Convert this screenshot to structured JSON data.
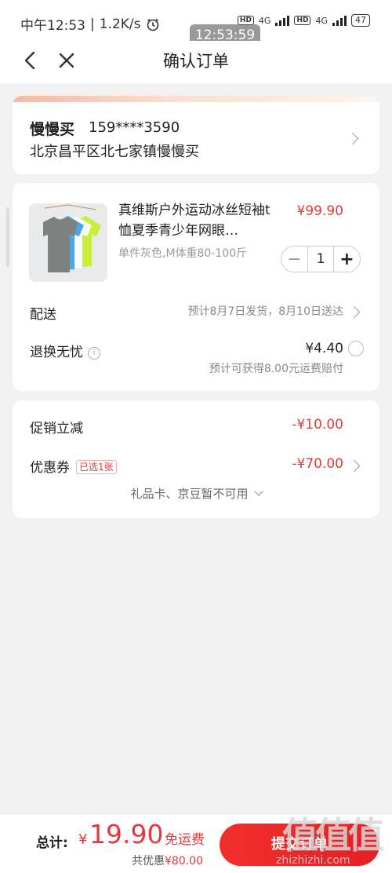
{
  "status_bar": {
    "time": "中午12:53",
    "speed": "1.2K/s",
    "signal1_tag": "HD",
    "signal1_net": "4G",
    "signal2_tag": "HD",
    "signal2_net": "4G",
    "battery": "47"
  },
  "time_bubble": "12:53:59",
  "nav": {
    "title": "确认订单"
  },
  "address": {
    "name": "慢慢买",
    "phone": "159****3590",
    "line": "北京昌平区北七家镇慢慢买"
  },
  "product": {
    "title": "真维斯户外运动冰丝短袖t恤夏季青少年网眼…",
    "price": "¥99.90",
    "spec": "单件灰色,M体重80-100斤",
    "quantity": "1",
    "minus": "−",
    "plus": "+"
  },
  "delivery": {
    "label": "配送",
    "value": "预计8月7日发货，8月10日送达"
  },
  "return_insurance": {
    "label": "退换无忧",
    "info_icon": "i",
    "price": "¥4.40",
    "note": "预计可获得8.00元运费赔付"
  },
  "promotions": {
    "instant_discount_label": "促销立减",
    "instant_discount_value": "-¥10.00",
    "coupon_label": "优惠券",
    "coupon_tag": "已选1张",
    "coupon_value": "-¥70.00",
    "note": "礼品卡、京豆暂不可用"
  },
  "checkout": {
    "total_label": "总计:",
    "currency": "¥",
    "total": "19.90",
    "free_shipping": "免运费",
    "saved_label": "共优惠",
    "saved_amount": "¥80.00",
    "submit": "提交订单"
  },
  "watermark": {
    "logo": "值值值",
    "site": "zhizhizhi.com"
  },
  "colors": {
    "accent": "#e4393c",
    "background": "#f2f2f2"
  }
}
